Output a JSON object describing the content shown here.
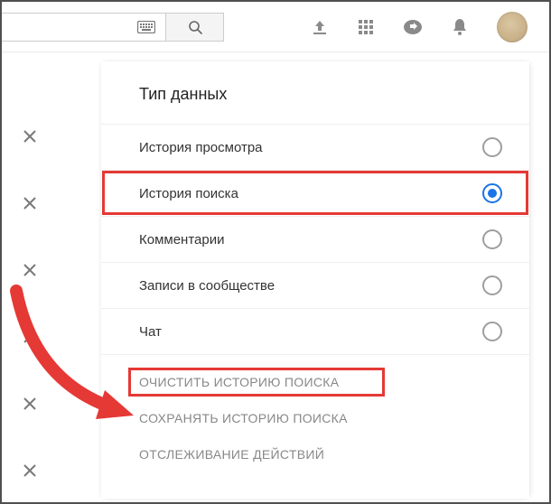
{
  "search": {
    "placeholder": ""
  },
  "panel": {
    "header": "Тип данных",
    "options": [
      {
        "label": "История просмотра",
        "selected": false,
        "highlight": false
      },
      {
        "label": "История поиска",
        "selected": true,
        "highlight": true
      },
      {
        "label": "Комментарии",
        "selected": false,
        "highlight": false
      },
      {
        "label": "Записи в сообществе",
        "selected": false,
        "highlight": false
      },
      {
        "label": "Чат",
        "selected": false,
        "highlight": false
      }
    ],
    "actions": [
      {
        "label": "ОЧИСТИТЬ ИСТОРИЮ ПОИСКА",
        "highlight": true
      },
      {
        "label": "СОХРАНЯТЬ ИСТОРИЮ ПОИСКА",
        "highlight": false
      },
      {
        "label": "ОТСЛЕЖИВАНИЕ ДЕЙСТВИЙ",
        "highlight": false
      }
    ]
  },
  "icons": {
    "keyboard": "keyboard-icon",
    "search": "search-icon",
    "upload": "upload-icon",
    "apps": "apps-icon",
    "share": "share-icon",
    "bell": "bell-icon",
    "avatar": "avatar"
  },
  "annotation": {
    "arrow_color": "#e53935",
    "highlight_color": "#e53935"
  }
}
